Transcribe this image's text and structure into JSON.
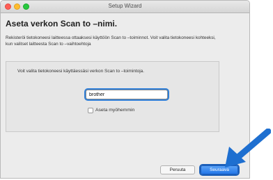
{
  "window": {
    "title": "Setup Wizard"
  },
  "heading": "Aseta verkon Scan to –nimi.",
  "intro": "Rekisteröi tietokoneesi laitteessa ottaaksesi käyttöön Scan to –toiminnot. Voit valita tietokoneesi kohteeksi, kun valitset laitteesta Scan to –vaihtoehtoja",
  "panel": {
    "text": "Voit valita tietokoneesi käyttäessäsi verkon Scan to –toimintoja.",
    "name_value": "brother",
    "checkbox_label": "Aseta myöhemmin",
    "checkbox_checked": false
  },
  "buttons": {
    "cancel": "Peruuta",
    "next": "Seuraava"
  },
  "colors": {
    "accent": "#2f7fd8",
    "arrow": "#1e6fd0"
  }
}
